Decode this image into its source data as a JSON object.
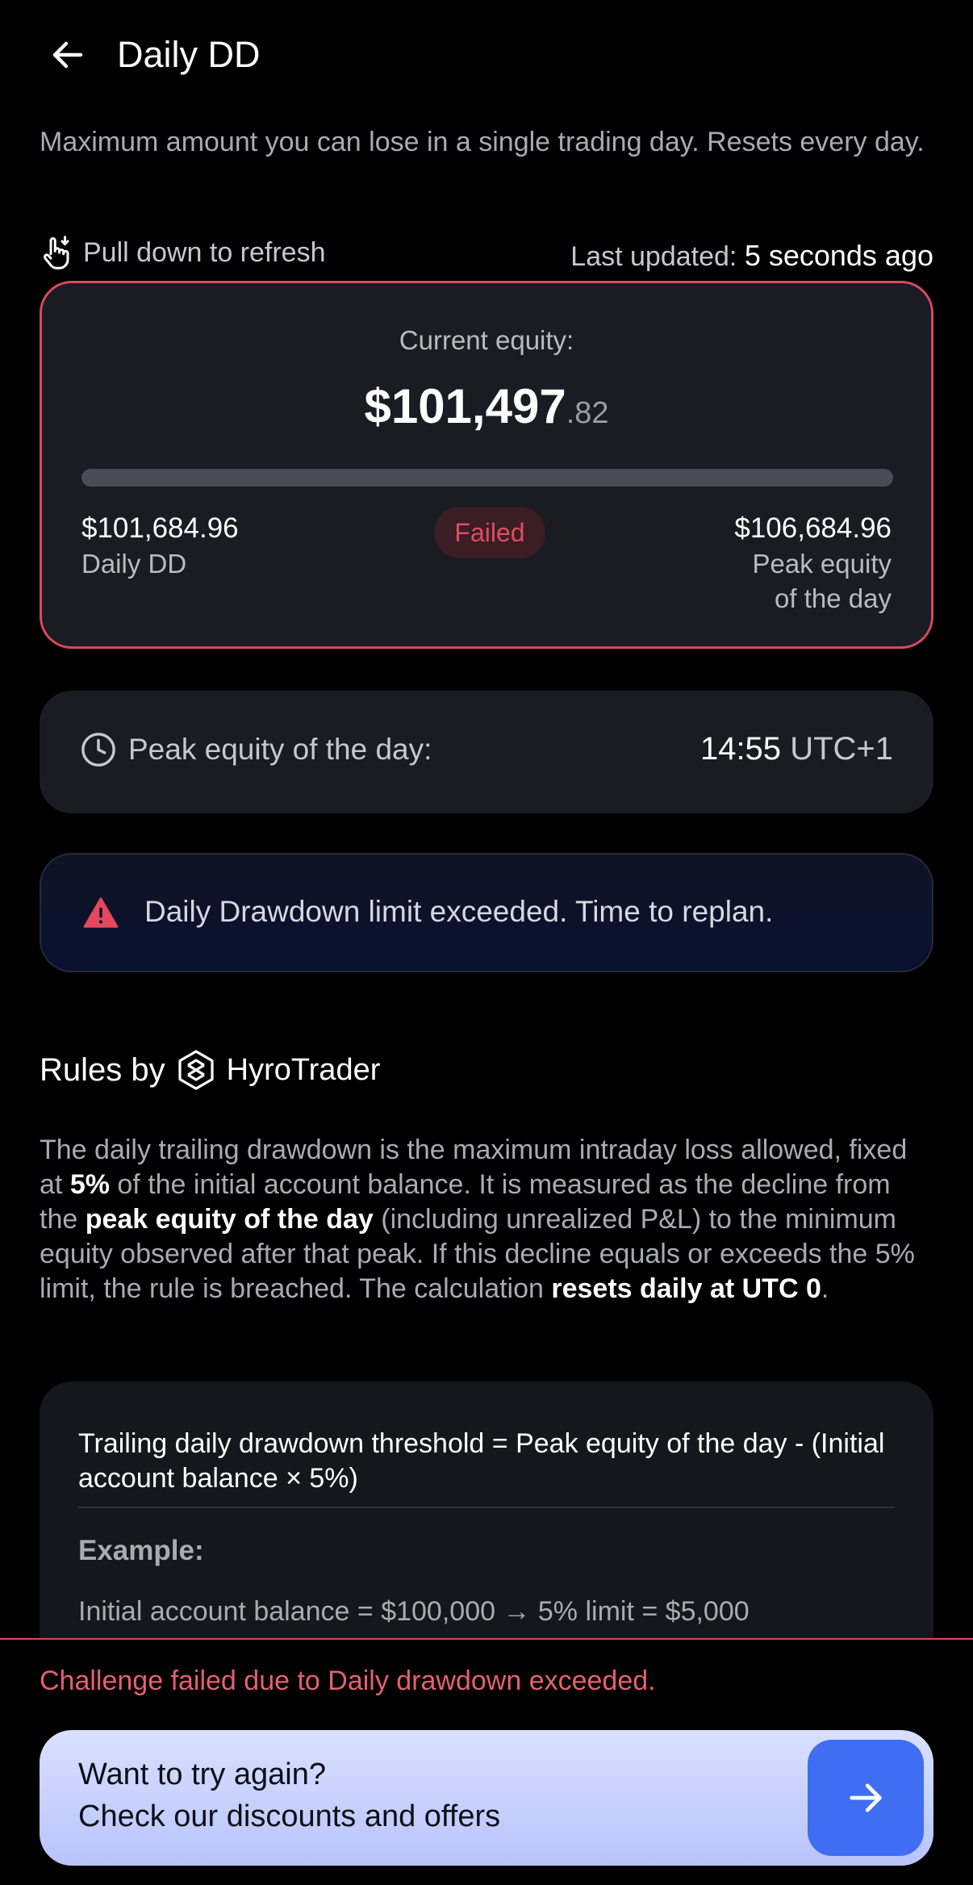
{
  "header": {
    "title": "Daily DD"
  },
  "subtitle": "Maximum amount you can lose in a single trading day. Resets every day.",
  "refresh": {
    "hint": "Pull down to refresh",
    "last_updated_label": "Last updated:",
    "last_updated_value": "5 seconds ago"
  },
  "equity_card": {
    "label": "Current equity:",
    "value_main": "$101,497",
    "value_cents": ".82",
    "progress_fraction": 1.0,
    "left_amount": "$101,684.96",
    "left_label": "Daily DD",
    "status": "Failed",
    "right_amount": "$106,684.96",
    "right_label_line1": "Peak equity",
    "right_label_line2": "of the day"
  },
  "peak_card": {
    "label": "Peak equity of the day:",
    "time": "14:55",
    "timezone": "UTC+1"
  },
  "alert": {
    "message": "Daily Drawdown limit exceeded. Time to replan."
  },
  "rules": {
    "heading": "Rules by",
    "brand": "HyroTrader",
    "p1": "The daily trailing drawdown is the maximum intraday loss allowed, fixed at ",
    "b1": "5%",
    "p2": " of the initial account balance. It is measured as the decline from the ",
    "b2": "peak equity of the day",
    "p3": " (including unrealized P&L) to the minimum equity observed after that peak. If this decline equals or exceeds the 5% limit, the rule is breached. The calculation ",
    "b3": "resets daily at UTC 0",
    "p4": "."
  },
  "formula": {
    "text": "Trailing daily drawdown threshold = Peak equity of the day - (Initial account balance × 5%)",
    "example_title": "Example:",
    "example_line": "Initial account balance = $100,000 → 5% limit = $5,000"
  },
  "bottom": {
    "fail_message": "Challenge failed due to Daily drawdown exceeded.",
    "cta_line1": "Want to try again?",
    "cta_line2": "Check our discounts and offers"
  },
  "colors": {
    "danger": "#d9495c",
    "card_bg": "#1a1b23",
    "cta_button": "#3f6ef2"
  }
}
